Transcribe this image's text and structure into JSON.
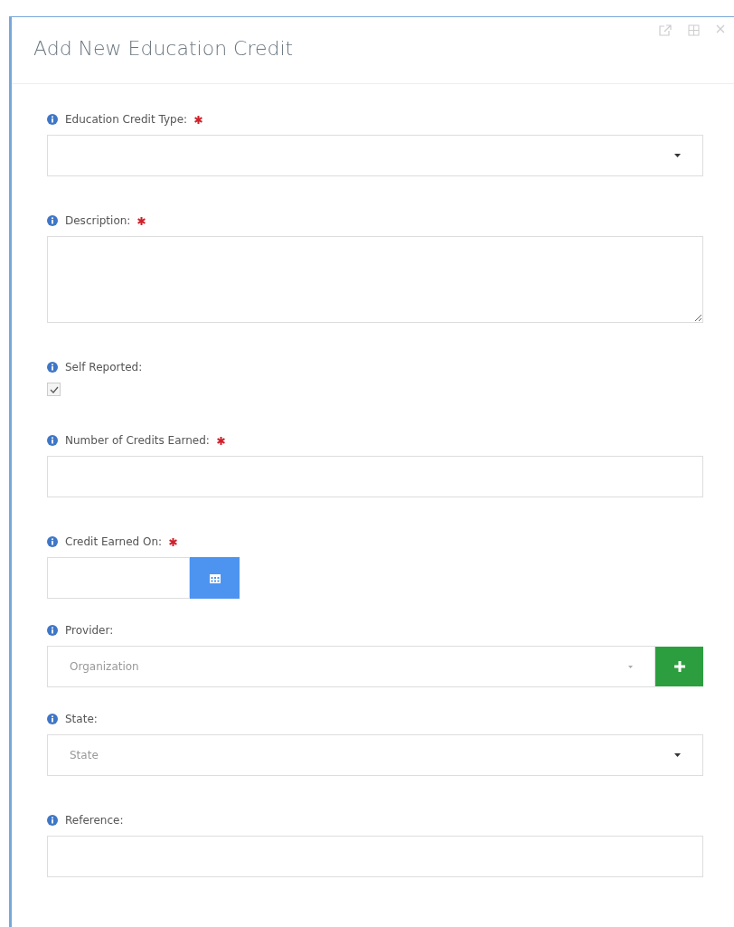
{
  "dialog": {
    "title": "Add New Education Credit"
  },
  "fields": [
    {
      "kind": "select",
      "label": "Education Credit Type:",
      "required": true
    },
    {
      "kind": "textarea",
      "label": "Description:",
      "required": true
    },
    {
      "kind": "checkbox",
      "label": "Self Reported:",
      "required": false,
      "checked": true
    },
    {
      "kind": "text",
      "label": "Number of Credits Earned:",
      "required": true
    },
    {
      "kind": "date",
      "label": "Credit Earned On:",
      "required": true
    },
    {
      "kind": "select_add",
      "label": "Provider:",
      "required": false,
      "placeholder": "Organization"
    },
    {
      "kind": "select",
      "label": "State:",
      "required": false,
      "placeholder": "State"
    },
    {
      "kind": "text",
      "label": "Reference:",
      "required": false
    }
  ]
}
